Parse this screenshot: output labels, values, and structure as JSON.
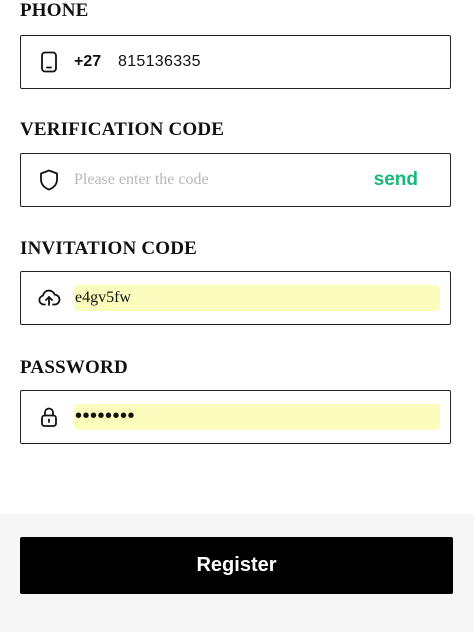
{
  "phone": {
    "label": "PHONE",
    "icon": "phone-icon",
    "country_code": "+27",
    "value": "815136335"
  },
  "verification": {
    "label": "VERIFICATION CODE",
    "icon": "shield-icon",
    "placeholder": "Please enter the code",
    "send_label": "send",
    "send_color": "#17b978"
  },
  "invitation": {
    "label": "INVITATION CODE",
    "icon": "upload-cloud-icon",
    "value": "e4gv5fw",
    "autofill_color": "#fbfdbd"
  },
  "password": {
    "label": "PASSWORD",
    "icon": "lock-icon",
    "masked_value": "••••••••"
  },
  "register": {
    "label": "Register"
  }
}
